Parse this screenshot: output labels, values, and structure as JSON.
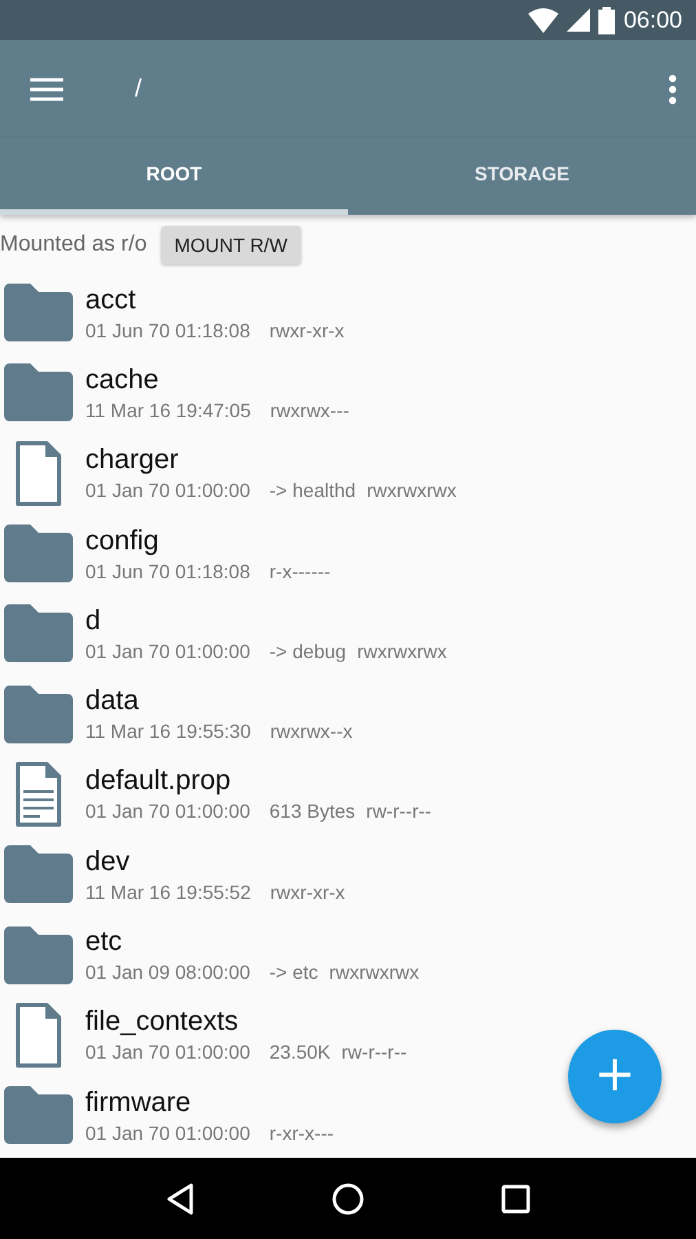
{
  "status_bar": {
    "time": "06:00"
  },
  "toolbar": {
    "path": "/"
  },
  "tabs": [
    {
      "label": "ROOT",
      "selected": true
    },
    {
      "label": "STORAGE",
      "selected": false
    }
  ],
  "mount": {
    "status": "Mounted as r/o",
    "button": "MOUNT R/W"
  },
  "files": [
    {
      "kind": "folder",
      "name": "acct",
      "date": "01 Jun 70 01:18:08",
      "perms": "rwxr-xr-x"
    },
    {
      "kind": "folder",
      "name": "cache",
      "date": "11 Mar 16 19:47:05",
      "perms": "rwxrwx---"
    },
    {
      "kind": "file",
      "name": "charger",
      "date": "01 Jan 70 01:00:00",
      "info": "-> healthd",
      "perms": "rwxrwxrwx"
    },
    {
      "kind": "folder",
      "name": "config",
      "date": "01 Jun 70 01:18:08",
      "perms": "r-x------"
    },
    {
      "kind": "folder",
      "name": "d",
      "date": "01 Jan 70 01:00:00",
      "info": "-> debug",
      "perms": "rwxrwxrwx"
    },
    {
      "kind": "folder",
      "name": "data",
      "date": "11 Mar 16 19:55:30",
      "perms": "rwxrwx--x"
    },
    {
      "kind": "text",
      "name": "default.prop",
      "date": "01 Jan 70 01:00:00",
      "info": "613 Bytes",
      "perms": "rw-r--r--"
    },
    {
      "kind": "folder",
      "name": "dev",
      "date": "11 Mar 16 19:55:52",
      "perms": "rwxr-xr-x"
    },
    {
      "kind": "folder",
      "name": "etc",
      "date": "01 Jan 09 08:00:00",
      "info": "-> etc",
      "perms": "rwxrwxrwx"
    },
    {
      "kind": "file",
      "name": "file_contexts",
      "date": "01 Jan 70 01:00:00",
      "info": "23.50K",
      "perms": "rw-r--r--"
    },
    {
      "kind": "folder",
      "name": "firmware",
      "date": "01 Jan 70 01:00:00",
      "perms": "r-xr-x---"
    }
  ],
  "fab": {
    "label": "+"
  }
}
